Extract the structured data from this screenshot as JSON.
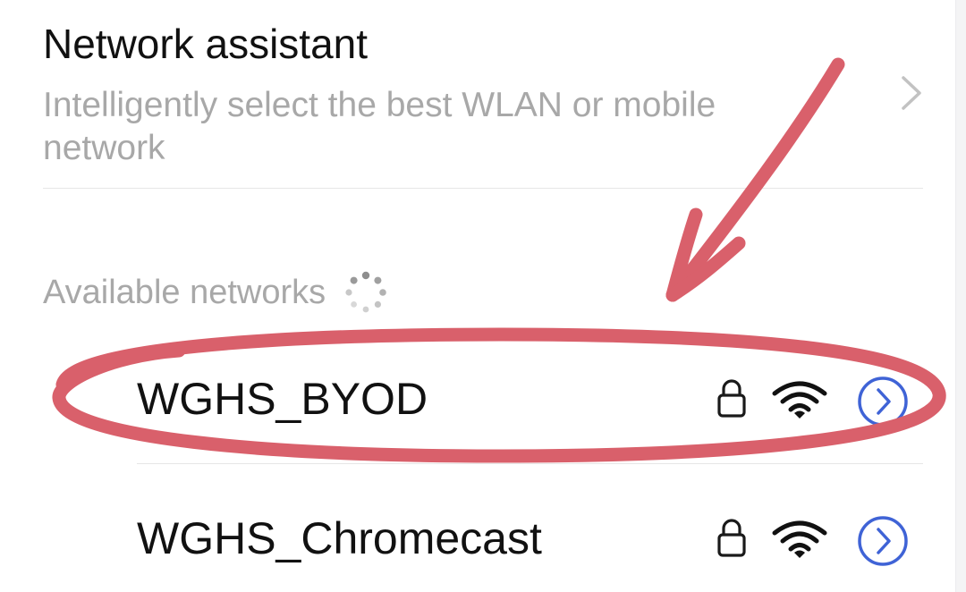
{
  "network_assistant": {
    "title": "Network assistant",
    "subtitle": "Intelligently select the best WLAN or mobile network",
    "chevron_icon": "chevron-right-icon"
  },
  "available_networks": {
    "header": "Available networks",
    "loading_icon": "loading-spinner-icon",
    "networks": [
      {
        "name": "WGHS_BYOD",
        "secured": true,
        "signal": "strong",
        "icons": [
          "lock-icon",
          "wifi-signal-icon",
          "info-arrow-icon"
        ]
      },
      {
        "name": "WGHS_Chromecast",
        "secured": true,
        "signal": "strong",
        "icons": [
          "lock-icon",
          "wifi-signal-icon",
          "info-arrow-icon"
        ]
      }
    ]
  },
  "annotation": {
    "color": "#d9606b",
    "shapes": [
      "arrow",
      "ellipse"
    ]
  },
  "colors": {
    "primary_text": "#111111",
    "secondary_text": "#a8a8a8",
    "accent_blue": "#3f63d6",
    "divider": "#e6e6e6"
  }
}
